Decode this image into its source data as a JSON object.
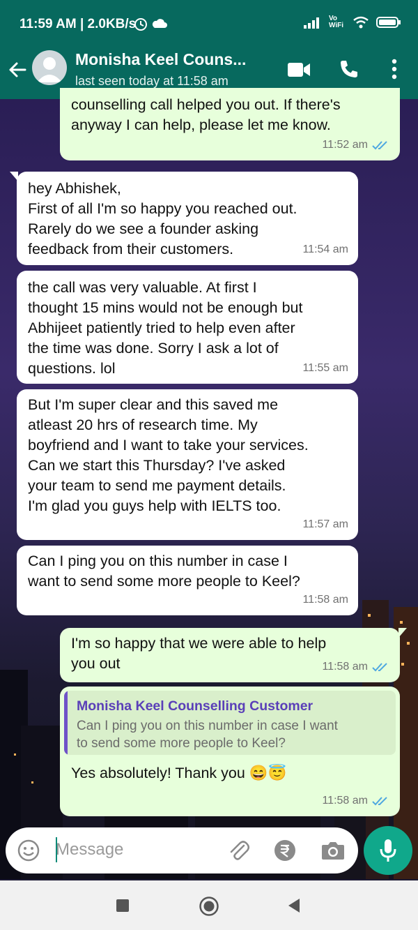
{
  "status_bar": {
    "time": "11:59 AM | 2.0KB/s",
    "network": "Vo WiFi"
  },
  "header": {
    "contact_name": "Monisha Keel Couns...",
    "last_seen": "last seen today at 11:58 am"
  },
  "messages": [
    {
      "direction": "out",
      "text": "counselling call helped you out. If there's\nanyway I can help, please let me know.",
      "time": "11:52 am"
    },
    {
      "direction": "in",
      "text": "hey Abhishek,\nFirst of all I'm so happy you reached out.\nRarely do we see a founder asking\nfeedback from their customers.",
      "time": "11:54 am"
    },
    {
      "direction": "in",
      "text": "the call was very valuable. At first I\nthought 15 mins would not be enough but\nAbhijeet patiently tried to help even after\nthe time was done. Sorry I ask a lot of\nquestions. lol",
      "time": "11:55 am"
    },
    {
      "direction": "in",
      "text": "But I'm super clear and this saved me\natleast 20 hrs of research time. My\nboyfriend and I want to take your services.\nCan we start this Thursday? I've asked\nyour team to send me payment details.\nI'm glad you guys help with IELTS too.",
      "time": "11:57 am"
    },
    {
      "direction": "in",
      "text": "Can I ping you on this number in case I\nwant to send some more people to Keel?",
      "time": "11:58 am"
    },
    {
      "direction": "out",
      "text": "I'm so happy that we were able to help\nyou out",
      "time": "11:58 am"
    },
    {
      "direction": "out",
      "quoted_name": "Monisha Keel Counselling Customer",
      "quoted_text": "Can I ping you on this number in case I want\nto send some more people to Keel?",
      "text": "Yes absolutely! Thank you 😄😇",
      "time": "11:58 am"
    }
  ],
  "composer": {
    "placeholder": "Message"
  },
  "colors": {
    "header": "#07695e",
    "outgoing_bubble": "#e7ffdb",
    "incoming_bubble": "#ffffff",
    "mic_button": "#10a88b",
    "read_tick": "#4fa8e0"
  },
  "icons": [
    "back-arrow-icon",
    "avatar-icon",
    "video-call-icon",
    "voice-call-icon",
    "more-options-icon",
    "emoji-icon",
    "attach-icon",
    "rupee-payment-icon",
    "camera-icon",
    "mic-icon",
    "nav-recents-icon",
    "nav-home-icon",
    "nav-back-icon"
  ]
}
